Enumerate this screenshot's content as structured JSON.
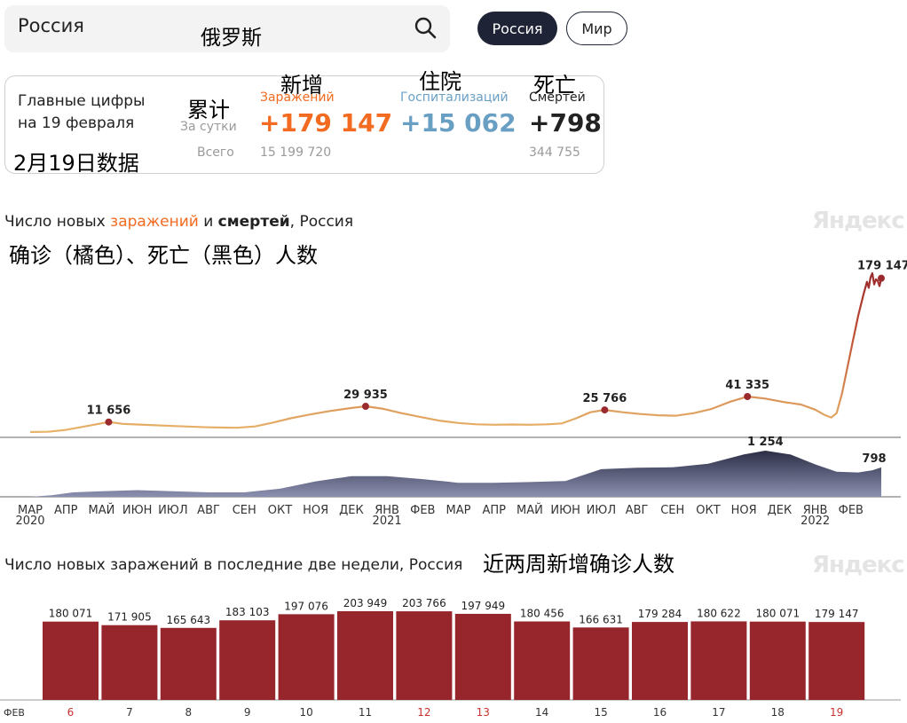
{
  "search": {
    "value": "Россия",
    "annotation": "俄罗斯"
  },
  "region_buttons": {
    "russia": "Россия",
    "world": "Мир"
  },
  "card": {
    "heading_line1": "Главные цифры",
    "heading_line2": "на 19 февраля",
    "heading_annotation": "2月19日数据",
    "per_day_label": "За сутки",
    "per_day_annotation": "累计",
    "total_label": "Всего",
    "infections": {
      "annotation": "新增",
      "label": "Заражений",
      "value": "+179 147",
      "total": "15 199 720",
      "color": "#f26b21"
    },
    "hospital": {
      "annotation": "住院",
      "label": "Госпитализаций",
      "value": "+15 062",
      "color": "#6a9fc4"
    },
    "deaths": {
      "annotation": "死亡",
      "label": "Смертей",
      "value": "+798",
      "total": "344 755",
      "color": "#222222"
    }
  },
  "chart1": {
    "title_part1": "Число новых ",
    "title_part2": "заражений",
    "title_part3": " и ",
    "title_part4": "смертей",
    "title_part5": ", Россия",
    "annotation": "确诊（橘色）、死亡（黑色）人数",
    "logo": "Яндекс"
  },
  "chart2": {
    "title": "Число новых заражений в последние две недели, Россия",
    "annotation": "近两周新增确诊人数",
    "logo": "Яндекс"
  },
  "chart_data": [
    {
      "type": "area",
      "title": "Число новых заражений и смертей, Россия",
      "x_tick_labels": [
        "МАР",
        "АПР",
        "МАЙ",
        "ИЮН",
        "ИЮЛ",
        "АВГ",
        "СЕН",
        "ОКТ",
        "НОЯ",
        "ДЕК",
        "ЯНВ",
        "ФЕВ",
        "МАР",
        "АПР",
        "МАЙ",
        "ИЮН",
        "ИЮЛ",
        "АВГ",
        "СЕН",
        "ОКТ",
        "НОЯ",
        "ДЕК",
        "ЯНВ",
        "ФЕВ"
      ],
      "year_labels": [
        {
          "label": "2020",
          "month_index": 0
        },
        {
          "label": "2021",
          "month_index": 10
        },
        {
          "label": "2022",
          "month_index": 22
        }
      ],
      "series": [
        {
          "name": "заражений",
          "color": "#e8b46a",
          "points": [
            [
              0,
              0
            ],
            [
              0.5,
              300
            ],
            [
              1,
              2500
            ],
            [
              1.6,
              7000
            ],
            [
              2.2,
              11656
            ],
            [
              2.6,
              9500
            ],
            [
              3,
              8800
            ],
            [
              4,
              7000
            ],
            [
              5,
              5500
            ],
            [
              5.8,
              5000
            ],
            [
              6.3,
              6500
            ],
            [
              6.8,
              11000
            ],
            [
              7.3,
              16000
            ],
            [
              7.8,
              20000
            ],
            [
              8.4,
              24500
            ],
            [
              9,
              28000
            ],
            [
              9.4,
              29935
            ],
            [
              9.9,
              27000
            ],
            [
              10.4,
              22000
            ],
            [
              11,
              17000
            ],
            [
              11.5,
              13000
            ],
            [
              12,
              10500
            ],
            [
              12.5,
              9000
            ],
            [
              13,
              8500
            ],
            [
              13.5,
              8800
            ],
            [
              14,
              8500
            ],
            [
              14.5,
              9000
            ],
            [
              14.9,
              10000
            ],
            [
              15.3,
              16000
            ],
            [
              15.7,
              23000
            ],
            [
              16.1,
              25766
            ],
            [
              16.6,
              23000
            ],
            [
              17.1,
              21000
            ],
            [
              17.6,
              19500
            ],
            [
              18.1,
              19000
            ],
            [
              18.6,
              22000
            ],
            [
              19.1,
              27000
            ],
            [
              19.6,
              35000
            ],
            [
              20.1,
              41335
            ],
            [
              20.6,
              39000
            ],
            [
              21.1,
              35000
            ],
            [
              21.6,
              32000
            ],
            [
              22.0,
              26000
            ],
            [
              22.25,
              20000
            ],
            [
              22.45,
              17000
            ],
            [
              22.6,
              22000
            ],
            [
              22.75,
              45000
            ],
            [
              22.9,
              75000
            ],
            [
              23.05,
              105000
            ],
            [
              23.2,
              135000
            ],
            [
              23.35,
              160000
            ],
            [
              23.45,
              175000
            ],
            [
              23.5,
              168000
            ],
            [
              23.55,
              180000
            ],
            [
              23.6,
              185000
            ],
            [
              23.65,
              172000
            ],
            [
              23.7,
              178000
            ],
            [
              23.75,
              176000
            ],
            [
              23.8,
              170000
            ],
            [
              23.85,
              179147
            ]
          ],
          "markers": [
            {
              "x": 2.2,
              "value": 11656,
              "label": "11 656"
            },
            {
              "x": 9.4,
              "value": 29935,
              "label": "29 935"
            },
            {
              "x": 16.1,
              "value": 25766,
              "label": "25 766"
            },
            {
              "x": 20.1,
              "value": 41335,
              "label": "41 335"
            },
            {
              "x": 23.85,
              "value": 179147,
              "label": "179 147"
            }
          ]
        },
        {
          "name": "смертей",
          "color": "#3b3f5c",
          "points": [
            [
              0,
              0
            ],
            [
              0.6,
              40
            ],
            [
              1.2,
              120
            ],
            [
              2,
              150
            ],
            [
              3,
              180
            ],
            [
              4,
              150
            ],
            [
              5,
              120
            ],
            [
              6,
              120
            ],
            [
              7,
              220
            ],
            [
              8,
              420
            ],
            [
              9,
              560
            ],
            [
              10,
              560
            ],
            [
              11,
              480
            ],
            [
              12,
              380
            ],
            [
              13,
              380
            ],
            [
              14,
              400
            ],
            [
              15,
              430
            ],
            [
              16,
              750
            ],
            [
              17,
              790
            ],
            [
              18,
              800
            ],
            [
              19,
              900
            ],
            [
              20,
              1150
            ],
            [
              20.6,
              1254
            ],
            [
              21.3,
              1150
            ],
            [
              22,
              880
            ],
            [
              22.6,
              680
            ],
            [
              23.2,
              660
            ],
            [
              23.6,
              720
            ],
            [
              23.85,
              798
            ]
          ],
          "labels": [
            {
              "x": 20.6,
              "value": 1254,
              "label": "1 254"
            },
            {
              "x": 23.85,
              "value": 798,
              "label": "798"
            }
          ]
        }
      ]
    },
    {
      "type": "bar",
      "title": "Число новых заражений в последние две недели, Россия",
      "month_label": "ФЕВ",
      "categories": [
        "6",
        "7",
        "8",
        "9",
        "10",
        "11",
        "12",
        "13",
        "14",
        "15",
        "16",
        "17",
        "18",
        "19"
      ],
      "values": [
        180071,
        171905,
        165643,
        183103,
        197076,
        203949,
        203766,
        197949,
        180456,
        166631,
        179284,
        180622,
        180071,
        179147
      ],
      "value_labels": [
        "180 071",
        "171 905",
        "165 643",
        "183 103",
        "197 076",
        "203 949",
        "203 766",
        "197 949",
        "180 456",
        "166 631",
        "179 284",
        "180 622",
        "180 071",
        "179 147"
      ],
      "weekend": [
        true,
        false,
        false,
        false,
        false,
        false,
        true,
        true,
        false,
        false,
        false,
        false,
        false,
        true
      ],
      "bar_color": "#96262c",
      "weekend_label_color": "#c9302c"
    }
  ]
}
